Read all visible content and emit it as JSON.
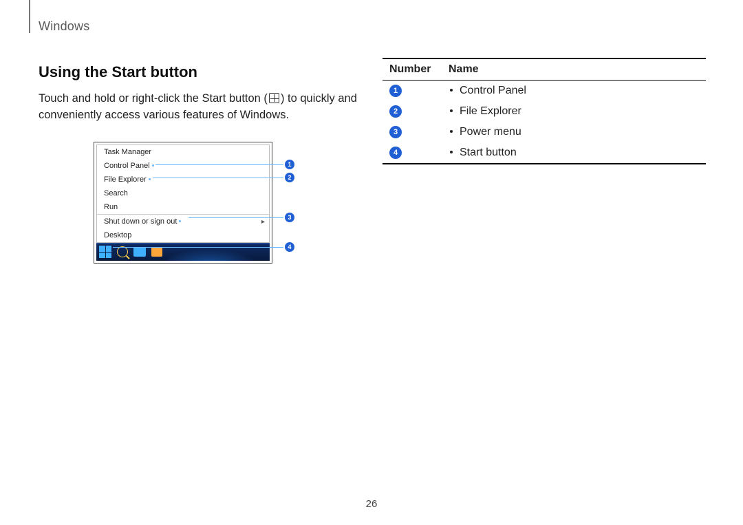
{
  "header": {
    "section": "Windows"
  },
  "left": {
    "heading": "Using the Start button",
    "para_before_icon": "Touch and hold or right-click the Start button (",
    "para_after_icon": ") to quickly and conveniently access various features of Windows."
  },
  "menu_items": [
    {
      "label": "Task Manager",
      "callout": null,
      "sep": false,
      "arrow": false
    },
    {
      "label": "Control Panel",
      "callout": 1,
      "sep": false,
      "arrow": false
    },
    {
      "label": "File Explorer",
      "callout": 2,
      "sep": false,
      "arrow": false
    },
    {
      "label": "Search",
      "callout": null,
      "sep": false,
      "arrow": false
    },
    {
      "label": "Run",
      "callout": null,
      "sep": false,
      "arrow": false
    },
    {
      "label": "Shut down or sign out",
      "callout": 3,
      "sep": true,
      "arrow": true
    },
    {
      "label": "Desktop",
      "callout": null,
      "sep": false,
      "arrow": false
    }
  ],
  "taskbar_callout": 4,
  "table": {
    "headers": {
      "c1": "Number",
      "c2": "Name"
    },
    "rows": [
      {
        "num": "1",
        "name": "Control Panel"
      },
      {
        "num": "2",
        "name": "File Explorer"
      },
      {
        "num": "3",
        "name": "Power menu"
      },
      {
        "num": "4",
        "name": "Start button"
      }
    ]
  },
  "page_number": "26"
}
